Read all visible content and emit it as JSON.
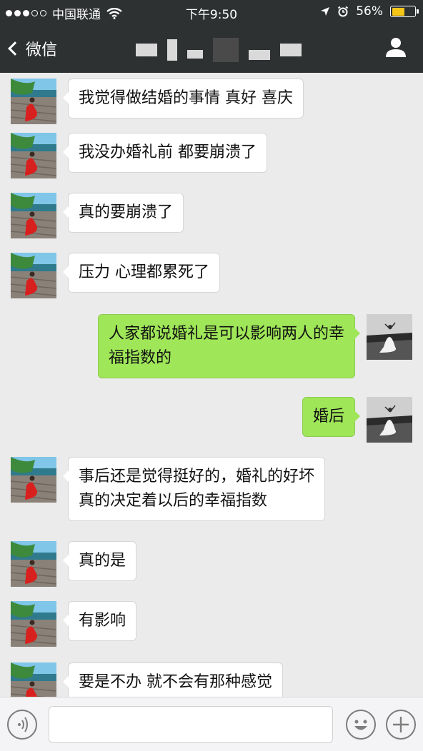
{
  "status_bar": {
    "carrier": "中国联通",
    "time": "下午9:50",
    "battery_percent": "56%",
    "battery_level": 0.56
  },
  "nav": {
    "back_label": "微信",
    "back_icon": "chevron-left-icon",
    "profile_icon": "person-icon"
  },
  "messages": [
    {
      "side": "left",
      "lines": [
        "我觉得做结婚的事情 真好 喜庆"
      ]
    },
    {
      "side": "left",
      "lines": [
        "我没办婚礼前 都要崩溃了"
      ]
    },
    {
      "side": "left",
      "lines": [
        "真的要崩溃了"
      ]
    },
    {
      "side": "left",
      "lines": [
        "压力 心理都累死了"
      ]
    },
    {
      "side": "right",
      "lines": [
        "人家都说婚礼是可以影响两人的幸",
        "福指数的"
      ]
    },
    {
      "side": "right",
      "lines": [
        "婚后"
      ]
    },
    {
      "side": "left",
      "lines": [
        "事后还是觉得挺好的，婚礼的好坏",
        "真的决定着以后的幸福指数"
      ]
    },
    {
      "side": "left",
      "lines": [
        "真的是"
      ]
    },
    {
      "side": "left",
      "lines": [
        "有影响"
      ]
    },
    {
      "side": "left",
      "lines": [
        "要是不办 就不会有那种感觉"
      ]
    }
  ],
  "input_bar": {
    "voice_icon": "voice-icon",
    "emoji_icon": "emoji-icon",
    "plus_icon": "plus-icon"
  },
  "colors": {
    "nav_bg": "#2e3132",
    "chat_bg": "#ebebeb",
    "my_bubble": "#9fe658",
    "their_bubble": "#ffffff"
  }
}
